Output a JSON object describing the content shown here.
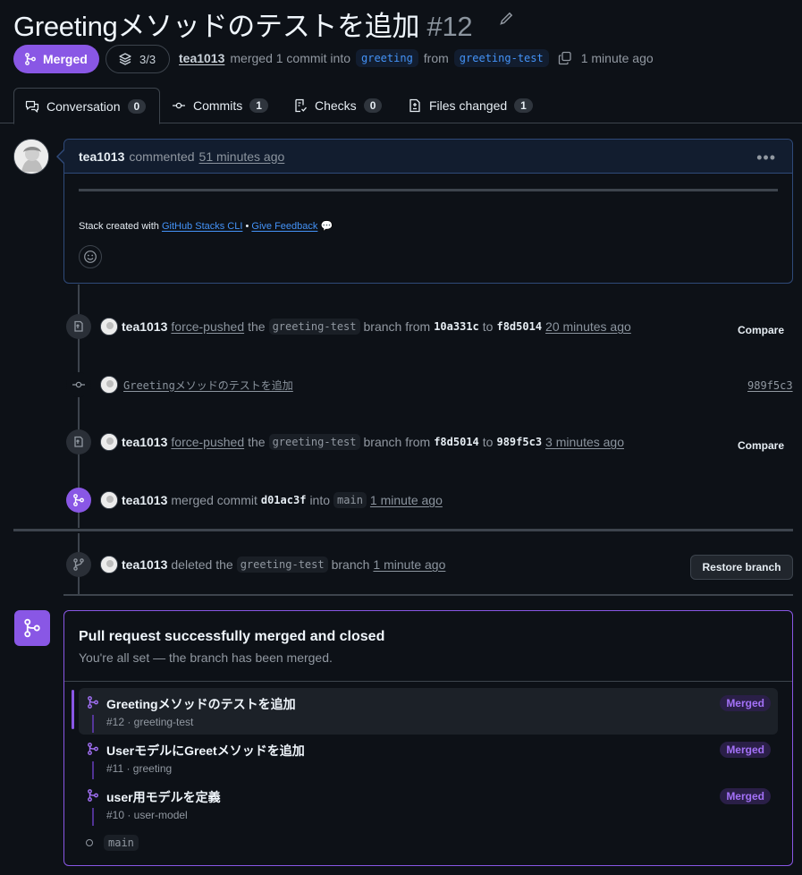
{
  "header": {
    "title": "Greetingメソッドのテストを追加",
    "number": "#12",
    "status": "Merged",
    "stack_count": "3/3",
    "author": "tea1013",
    "merged_text": "merged 1 commit into",
    "base_branch": "greeting",
    "from_text": "from",
    "head_branch": "greeting-test",
    "time": "1 minute ago"
  },
  "tabs": [
    {
      "label": "Conversation",
      "count": "0"
    },
    {
      "label": "Commits",
      "count": "1"
    },
    {
      "label": "Checks",
      "count": "0"
    },
    {
      "label": "Files changed",
      "count": "1"
    }
  ],
  "comment": {
    "author": "tea1013",
    "action": "commented",
    "time": "51 minutes ago",
    "note_prefix": "Stack created with",
    "note_link": "GitHub Stacks CLI",
    "note_sep": "•",
    "note_feedback": "Give Feedback",
    "note_emoji": "💬"
  },
  "timeline": {
    "push1": {
      "author": "tea1013",
      "action": "force-pushed",
      "the": "the",
      "branch": "greeting-test",
      "branch_from": "branch from",
      "from_sha": "10a331c",
      "to": "to",
      "to_sha": "f8d5014",
      "time": "20 minutes ago",
      "button": "Compare"
    },
    "commit": {
      "message": "Greetingメソッドのテストを追加",
      "sha": "989f5c3"
    },
    "push2": {
      "author": "tea1013",
      "action": "force-pushed",
      "the": "the",
      "branch": "greeting-test",
      "branch_from": "branch from",
      "from_sha": "f8d5014",
      "to": "to",
      "to_sha": "989f5c3",
      "time": "3 minutes ago",
      "button": "Compare"
    },
    "merge": {
      "author": "tea1013",
      "action": "merged commit",
      "sha": "d01ac3f",
      "into": "into",
      "branch": "main",
      "time": "1 minute ago"
    },
    "delete": {
      "author": "tea1013",
      "action": "deleted the",
      "branch": "greeting-test",
      "branch_word": "branch",
      "time": "1 minute ago",
      "button": "Restore branch"
    }
  },
  "merge_box": {
    "title": "Pull request successfully merged and closed",
    "subtitle": "You're all set — the branch has been merged.",
    "stack": [
      {
        "title": "Greetingメソッドのテストを追加",
        "sub": "#12 · greeting-test",
        "badge": "Merged"
      },
      {
        "title": "UserモデルにGreetメソッドを追加",
        "sub": "#11 · greeting",
        "badge": "Merged"
      },
      {
        "title": "user用モデルを定義",
        "sub": "#10 · user-model",
        "badge": "Merged"
      }
    ],
    "base": "main"
  }
}
